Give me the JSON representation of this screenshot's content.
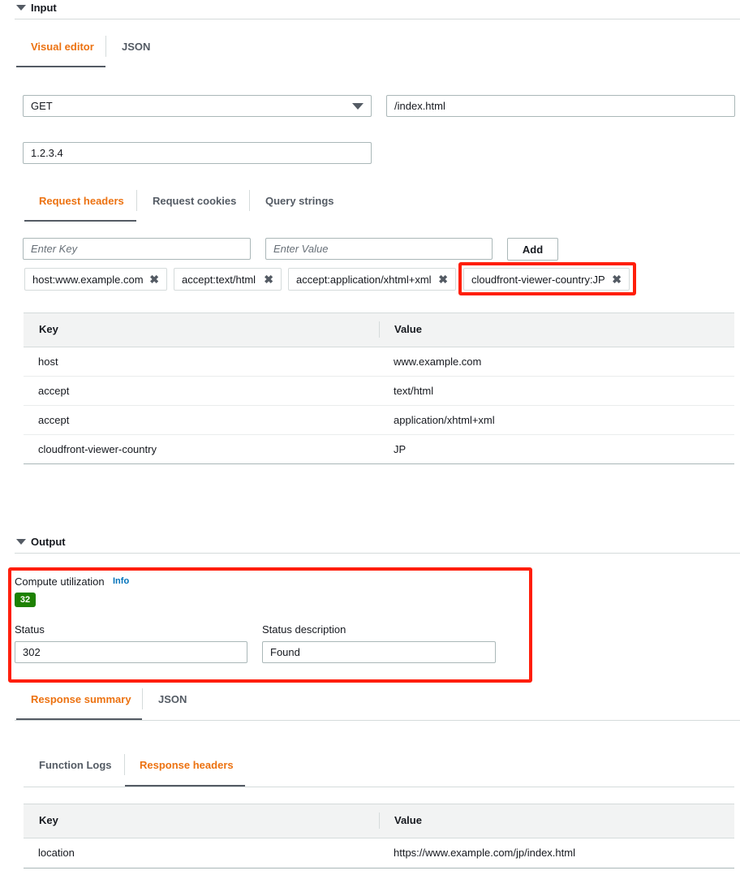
{
  "input": {
    "title": "Input",
    "tabs": [
      "Visual editor",
      "JSON"
    ],
    "method": "GET",
    "path": "/index.html",
    "ip": "1.2.3.4",
    "subtabs": [
      "Request headers",
      "Request cookies",
      "Query strings"
    ],
    "key_placeholder": "Enter Key",
    "value_placeholder": "Enter Value",
    "add_label": "Add",
    "tokens": [
      "host:www.example.com",
      "accept:text/html",
      "accept:application/xhtml+xml",
      "cloudfront-viewer-country:JP"
    ],
    "table": {
      "headers": [
        "Key",
        "Value"
      ],
      "rows": [
        [
          "host",
          "www.example.com"
        ],
        [
          "accept",
          "text/html"
        ],
        [
          "accept",
          "application/xhtml+xml"
        ],
        [
          "cloudfront-viewer-country",
          "JP"
        ]
      ]
    }
  },
  "output": {
    "title": "Output",
    "compute_label": "Compute utilization",
    "info_label": "Info",
    "compute_value": "32",
    "status_label": "Status",
    "status_value": "302",
    "status_desc_label": "Status description",
    "status_desc_value": "Found",
    "tabs": [
      "Response summary",
      "JSON"
    ],
    "subtabs": [
      "Function Logs",
      "Response headers"
    ],
    "table": {
      "headers": [
        "Key",
        "Value"
      ],
      "rows": [
        [
          "location",
          "https://www.example.com/jp/index.html"
        ]
      ]
    }
  },
  "colors": {
    "accent": "#ec7211",
    "highlight": "#ff1e0a",
    "badge": "#1d8102",
    "link": "#0073bb"
  }
}
